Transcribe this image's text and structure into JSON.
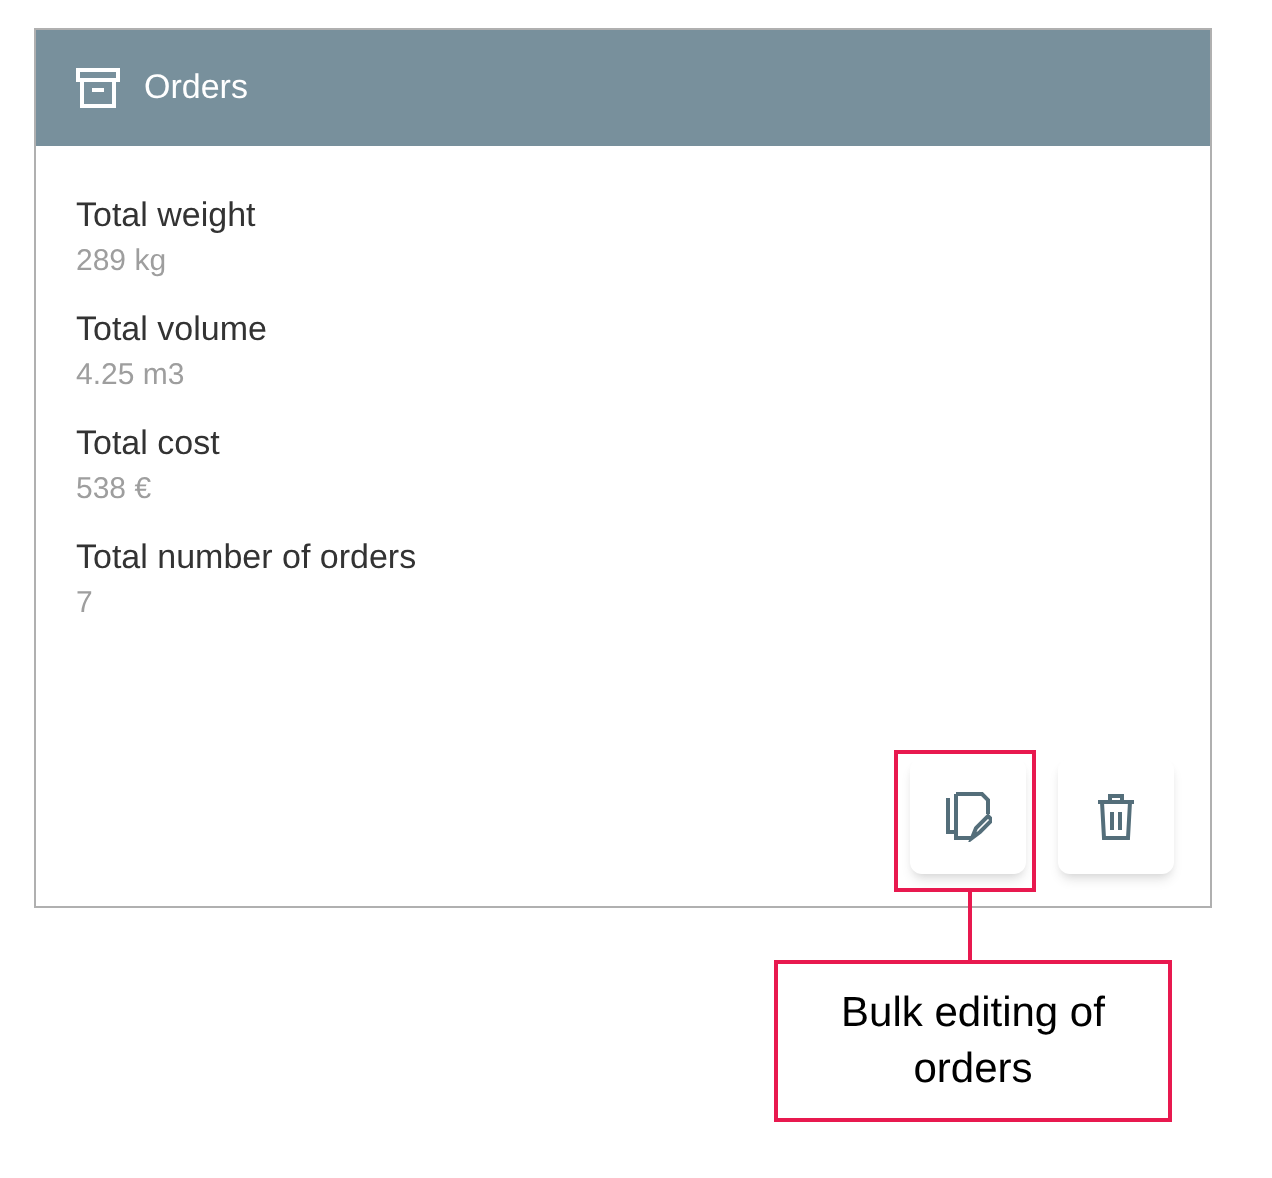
{
  "card": {
    "title": "Orders"
  },
  "stats": [
    {
      "label": "Total weight",
      "value": "289 kg"
    },
    {
      "label": "Total volume",
      "value": "4.25 m3"
    },
    {
      "label": "Total cost",
      "value": "538 €"
    },
    {
      "label": "Total number of orders",
      "value": "7"
    }
  ],
  "callout": {
    "text": "Bulk editing of orders"
  }
}
